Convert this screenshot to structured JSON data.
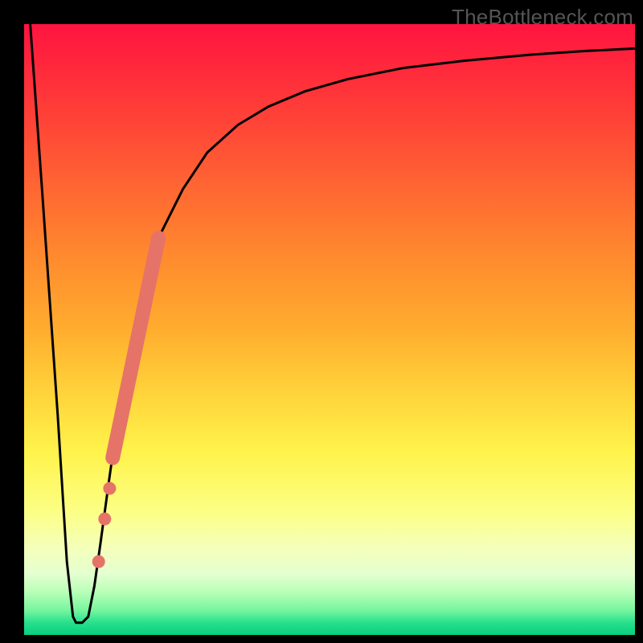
{
  "watermark": "TheBottleneck.com",
  "chart_data": {
    "type": "line",
    "title": "",
    "xlabel": "",
    "ylabel": "",
    "xlim": [
      0,
      100
    ],
    "ylim": [
      0,
      100
    ],
    "grid": false,
    "legend": false,
    "background": "rainbow-gradient vertical (red top → green bottom)",
    "series": [
      {
        "name": "bottleneck-curve",
        "color": "#000000",
        "x": [
          1.0,
          3.0,
          5.5,
          7.0,
          8.0,
          8.5,
          9.5,
          10.5,
          11.5,
          12.5,
          14.0,
          16.0,
          19.0,
          22.0,
          26.0,
          30.0,
          35.0,
          40.0,
          46.0,
          53.0,
          62.0,
          72.0,
          83.0,
          92.0,
          100.0
        ],
        "y": [
          100,
          72.0,
          36.0,
          12.0,
          3.0,
          2.0,
          2.0,
          3.0,
          8.0,
          15.0,
          26.0,
          40.0,
          55.0,
          65.0,
          73.0,
          79.0,
          83.5,
          86.5,
          89.0,
          91.0,
          92.8,
          94.0,
          95.0,
          95.6,
          96.0
        ]
      },
      {
        "name": "highlight-segment",
        "color": "#e57368",
        "style": "thick-line",
        "x": [
          14.5,
          22.0
        ],
        "y": [
          29.0,
          65.0
        ]
      }
    ],
    "markers": [
      {
        "name": "dot",
        "x": 14.0,
        "y": 24.0,
        "color": "#e57368",
        "r": 8
      },
      {
        "name": "dot",
        "x": 13.2,
        "y": 19.0,
        "color": "#e57368",
        "r": 8
      },
      {
        "name": "dot",
        "x": 12.2,
        "y": 12.0,
        "color": "#e57368",
        "r": 8
      }
    ]
  }
}
